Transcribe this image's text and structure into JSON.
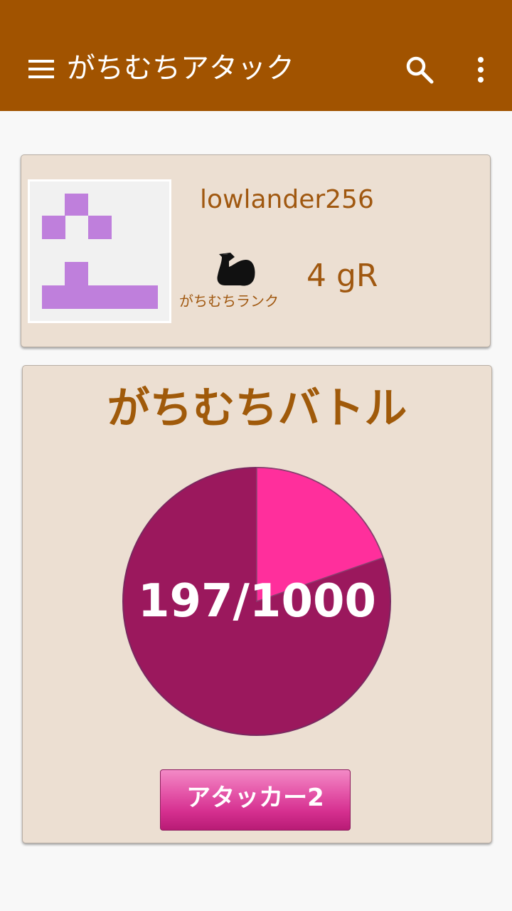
{
  "app_bar": {
    "title": "がちむちアタック",
    "background": "#a15300",
    "icons": [
      "menu-icon",
      "search-icon",
      "more-vert-icon"
    ]
  },
  "profile": {
    "username": "lowlander256",
    "rank_icon": "flexed-bicep-icon",
    "rank_label": "がちむちランク",
    "rank_value": "4 gR"
  },
  "battle": {
    "title": "がちむちバトル",
    "progress_text": "197/1000",
    "progress": {
      "current": 197,
      "max": 1000
    },
    "colors": {
      "filled": "#ff2f9c",
      "remaining": "#9b185d"
    },
    "button_label": "アタッカー2"
  }
}
